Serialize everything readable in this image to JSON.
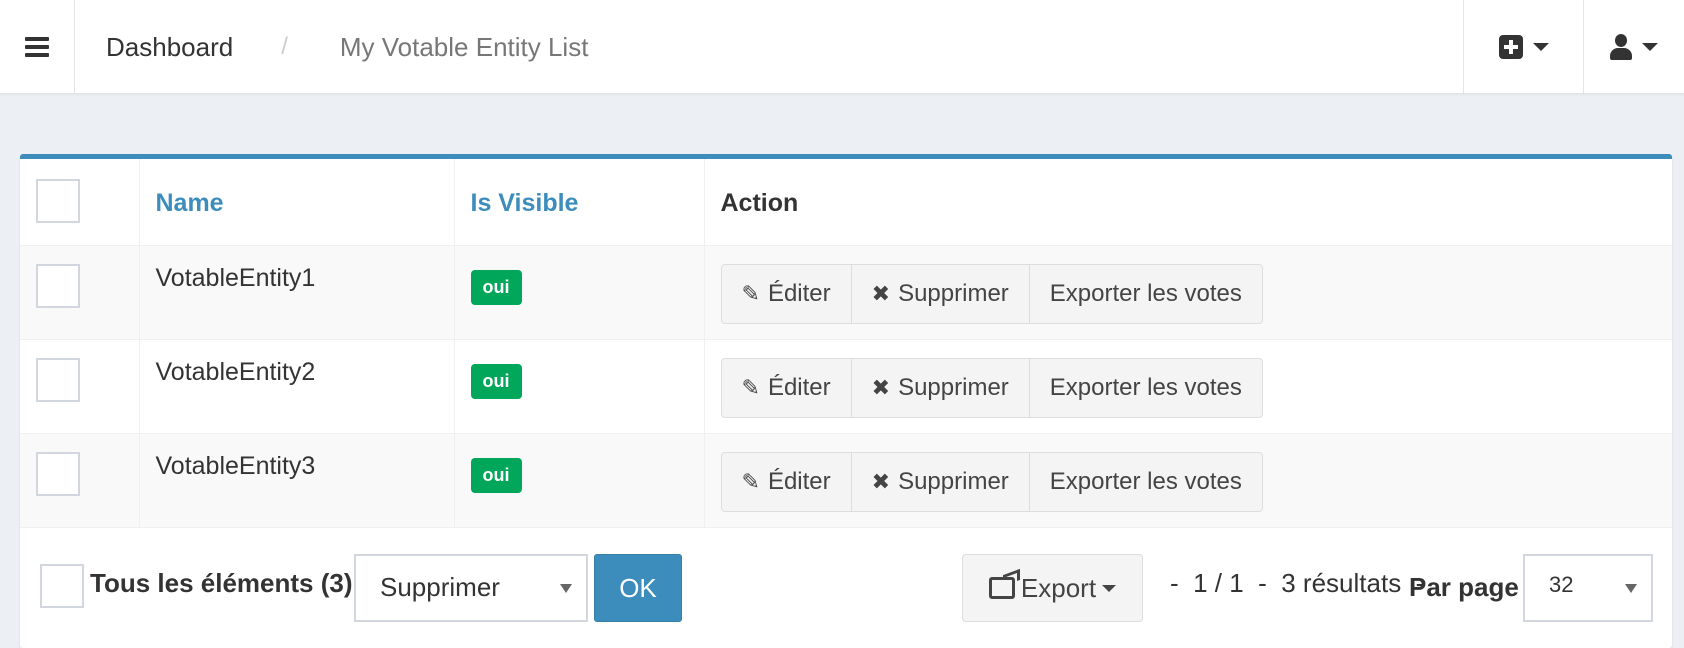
{
  "navbar": {
    "breadcrumb": {
      "home": "Dashboard",
      "separator": "/",
      "current": "My Votable Entity List"
    }
  },
  "table": {
    "columns": {
      "name": "Name",
      "is_visible": "Is Visible",
      "action": "Action"
    },
    "rows": [
      {
        "name": "VotableEntity1",
        "visible": "oui"
      },
      {
        "name": "VotableEntity2",
        "visible": "oui"
      },
      {
        "name": "VotableEntity3",
        "visible": "oui"
      }
    ],
    "actions": {
      "edit": "Éditer",
      "delete": "Supprimer",
      "export_votes": "Exporter les votes"
    }
  },
  "footer": {
    "all_elements_label": "Tous les éléments (3)",
    "batch_action_selected": "Supprimer",
    "ok_label": "OK",
    "export_label": "Export",
    "pager_info": "-  1 / 1  -  3 résultats  -",
    "per_page_label": "Par page",
    "per_page_value": "32"
  },
  "colors": {
    "accent": "#3c8dbc",
    "badge_green": "#00a65a",
    "background": "#ecf0f5"
  }
}
